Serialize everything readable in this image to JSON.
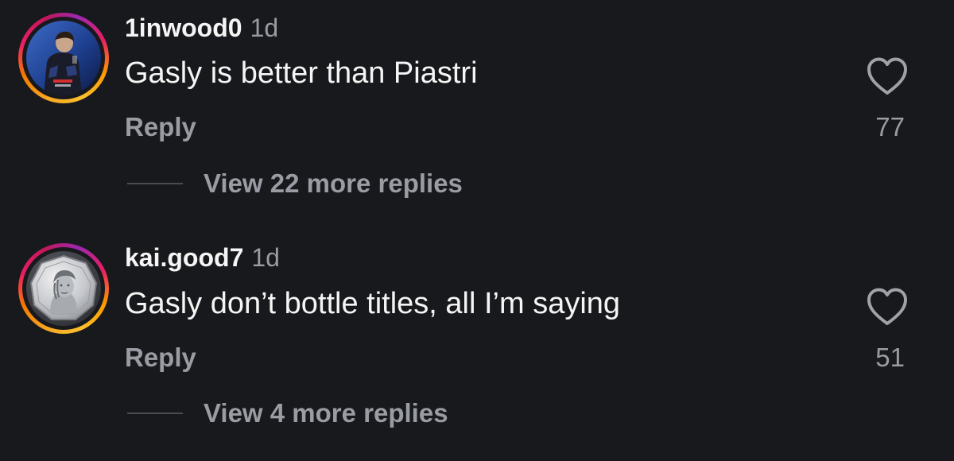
{
  "comments": [
    {
      "username": "1inwood0",
      "time": "1d",
      "text": "Gasly is better than Piastri",
      "reply_label": "Reply",
      "likes": "77",
      "view_replies": "View 22 more replies",
      "avatar": "rider-photo-avatar"
    },
    {
      "username": "kai.good7",
      "time": "1d",
      "text": "Gasly don’t bottle titles, all I’m saying",
      "reply_label": "Reply",
      "likes": "51",
      "view_replies": "View 4 more replies",
      "avatar": "coin-portrait-avatar"
    }
  ],
  "icons": {
    "like": "heart-outline-icon"
  },
  "colors": {
    "background": "#18191c",
    "primary_text": "#f5f5f5",
    "secondary_text": "#9a9ca3",
    "story_ring": [
      "#f9a825",
      "#e91e63",
      "#9c27b0"
    ]
  }
}
